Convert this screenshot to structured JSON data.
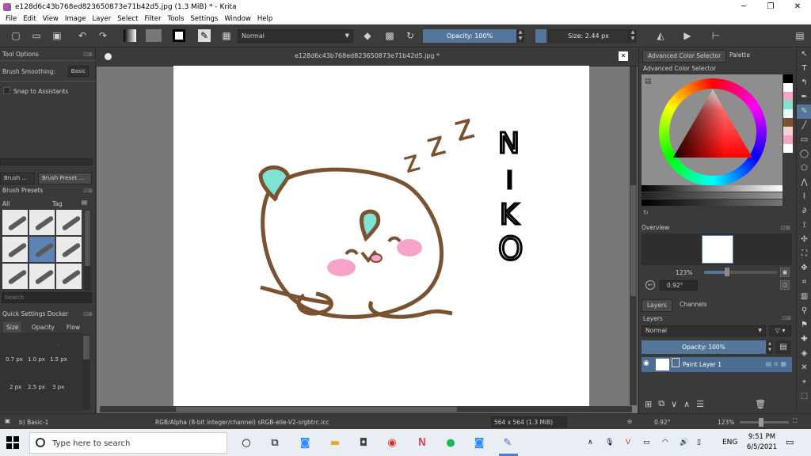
{
  "window": {
    "title": "e128d6c43b768ed823650873e71b42d5.jpg (1.3 MiB)  * - Krita",
    "min": "─",
    "max": "❐",
    "close": "✕"
  },
  "menu": [
    "File",
    "Edit",
    "View",
    "Image",
    "Layer",
    "Select",
    "Filter",
    "Tools",
    "Settings",
    "Window",
    "Help"
  ],
  "toolbar": {
    "blend_mode": "Normal",
    "opacity_label": "Opacity: 100%",
    "size_label": "Size: 2.44 px"
  },
  "tool_options": {
    "title": "Tool Options",
    "brush_smoothing_label": "Brush Smoothing:",
    "brush_smoothing_value": "Basic",
    "snap_label": "Snap to Assistants"
  },
  "brush_tabs": [
    "Brush ...",
    "Brush Preset ..."
  ],
  "brush_presets": {
    "title": "Brush Presets",
    "filter_value": "All",
    "tag_label": "Tag",
    "search_placeholder": "Search"
  },
  "quick_settings": {
    "title": "Quick Settings Docker",
    "tabs": [
      "Size",
      "Opacity",
      "Flow"
    ],
    "sizes": [
      "0.7 px",
      "1.0 px",
      "1.5 px",
      "2 px",
      "2.5 px",
      "3 px"
    ]
  },
  "document": {
    "tab_title": "e128d6c43b768ed823650873e71b42d5.jpg *",
    "close": "✕"
  },
  "drawing": {
    "text": [
      "N",
      "I",
      "K",
      "O"
    ],
    "sleep_letters": [
      "Z",
      "Z",
      "Z"
    ],
    "outline_color": "#7a5230",
    "leaf_color": "#7fe3d3",
    "cheek_color": "#f5a3c7"
  },
  "color_selector": {
    "tabs": [
      "Advanced Color Selector",
      "Palette"
    ],
    "title": "Advanced Color Selector",
    "swatches": [
      "#000000",
      "#ffffff",
      "#f5a3c7",
      "#7fe3d3",
      "#7a5230",
      "#f5d0d0",
      "#f5a3c7",
      "#ffffff"
    ]
  },
  "overview": {
    "title": "Overview",
    "zoom": "123%",
    "rotation": "0.92°"
  },
  "layers": {
    "tabs": [
      "Layers",
      "Channels"
    ],
    "title": "Layers",
    "blend_mode": "Normal",
    "opacity_label": "Opacity: 100%",
    "layer_name": "Paint Layer 1"
  },
  "statusbar": {
    "brush": "b) Basic-1",
    "color_space": "RGB/Alpha (8-bit integer/channel)  sRGB-elle-V2-srgbtrc.icc",
    "dimensions": "564 x 564 (1.3 MiB)",
    "rotation": "0.92°",
    "zoom": "123%"
  },
  "taskbar": {
    "search_placeholder": "Type here to search",
    "language": "ENG",
    "time": "9:51 PM",
    "date": "6/5/2021"
  }
}
